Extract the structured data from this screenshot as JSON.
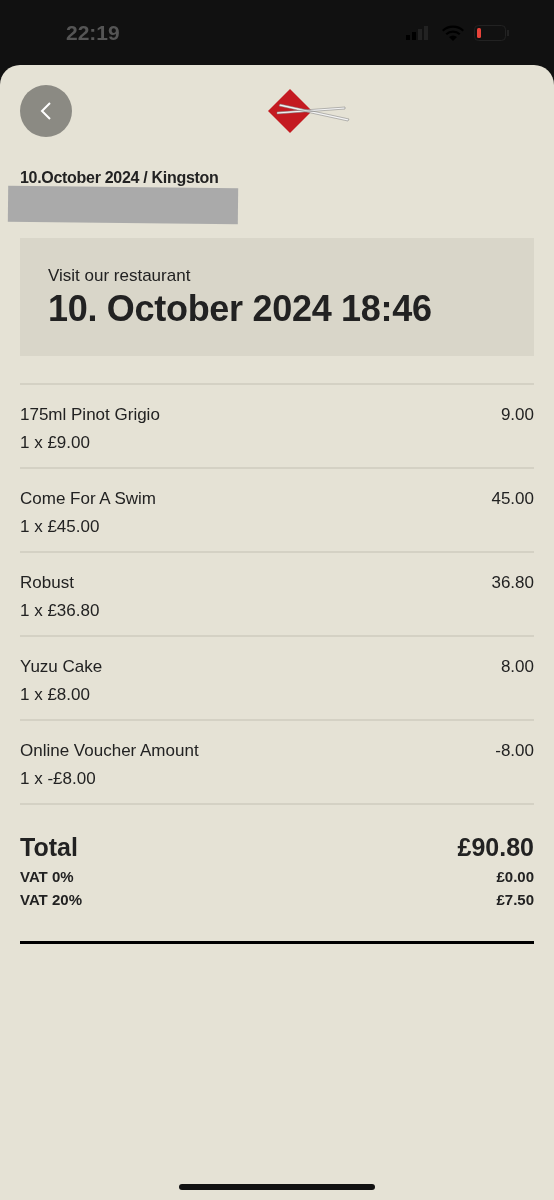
{
  "status_bar": {
    "time": "22:19"
  },
  "header": {
    "subtitle": "10.October 2024 / Kingston"
  },
  "visit": {
    "label": "Visit our restaurant",
    "datetime": "10. October 2024 18:46"
  },
  "items": [
    {
      "name": "175ml Pinot Grigio",
      "quantity": "1 x £9.00",
      "amount": "9.00"
    },
    {
      "name": "Come For A Swim",
      "quantity": "1 x £45.00",
      "amount": "45.00"
    },
    {
      "name": "Robust",
      "quantity": "1 x £36.80",
      "amount": "36.80"
    },
    {
      "name": "Yuzu Cake",
      "quantity": "1 x £8.00",
      "amount": "8.00"
    },
    {
      "name": "Online Voucher Amount",
      "quantity": "1 x -£8.00",
      "amount": "-8.00"
    }
  ],
  "total": {
    "label": "Total",
    "amount": "£90.80"
  },
  "taxes": [
    {
      "label": "VAT 0%",
      "amount": "£0.00"
    },
    {
      "label": "VAT 20%",
      "amount": "£7.50"
    }
  ]
}
